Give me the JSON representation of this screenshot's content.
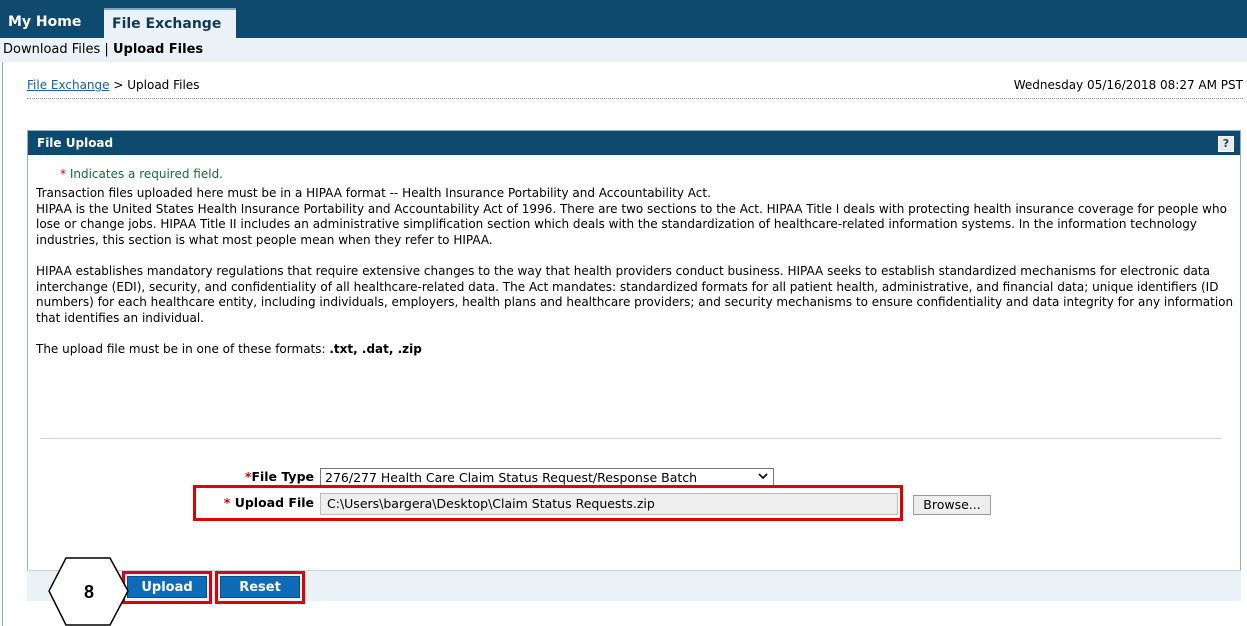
{
  "tabs": {
    "home": "My Home",
    "file_exchange": "File Exchange"
  },
  "subnav": {
    "download": "Download Files",
    "separator": "|",
    "upload": "Upload Files"
  },
  "breadcrumb": {
    "link": "File Exchange",
    "sep": ">",
    "current": "Upload Files"
  },
  "datetime": "Wednesday 05/16/2018 08:27 AM PST",
  "panel": {
    "title": "File Upload",
    "help_icon": "?",
    "required_star": "*",
    "required_note": "Indicates a required field.",
    "para1_line1": "Transaction files uploaded here must be in a HIPAA format -- Health Insurance Portability and Accountability Act.",
    "para1_line2": "HIPAA is the United States Health Insurance Portability and Accountability Act of 1996. There are two sections to the Act. HIPAA Title I deals with protecting health insurance coverage for people who lose or change jobs. HIPAA Title II includes an administrative simplification section which deals with the standardization of healthcare-related information systems. In the information technology industries, this section is what most people mean when they refer to HIPAA.",
    "para2": "HIPAA establishes mandatory regulations that require extensive changes to the way that health providers conduct business. HIPAA seeks to establish standardized mechanisms for electronic data interchange (EDI), security, and confidentiality of all healthcare-related data. The Act mandates: standardized formats for all patient health, administrative, and financial data; unique identifiers (ID numbers) for each healthcare entity, including individuals, employers, health plans and healthcare providers; and security mechanisms to ensure confidentiality and data integrity for any information that identifies an individual.",
    "formats_prefix": "The upload file must be in one of these formats:",
    "formats": ".txt, .dat, .zip"
  },
  "form": {
    "file_type_star": "*",
    "file_type_label": "File Type",
    "file_type_value": "276/277 Health Care Claim Status Request/Response Batch",
    "upload_star": "*",
    "upload_label": "Upload File",
    "upload_value": "C:\\Users\\bargera\\Desktop\\Claim Status Requests.zip",
    "browse_label": "Browse..."
  },
  "buttons": {
    "upload": "Upload",
    "reset": "Reset"
  },
  "callout": {
    "step": "8"
  },
  "colors": {
    "header": "#0d4a6e",
    "button": "#0e6bb8",
    "highlight": "#e00000",
    "required": "#d40000"
  }
}
